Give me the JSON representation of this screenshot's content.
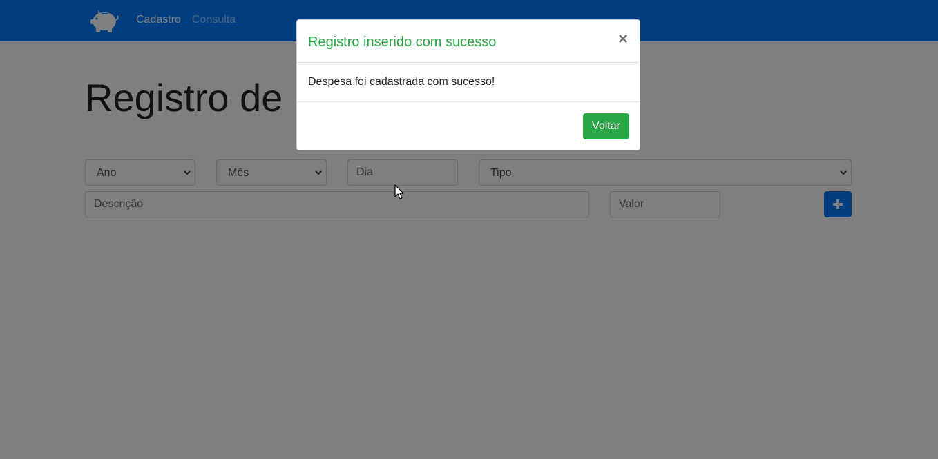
{
  "navbar": {
    "brand_icon": "piggy-bank-icon",
    "links": [
      {
        "label": "Cadastro",
        "active": true
      },
      {
        "label": "Consulta",
        "active": false
      }
    ],
    "bg_color": "#007bff"
  },
  "main": {
    "title": "Registro de",
    "form": {
      "ano": {
        "selected": "Ano"
      },
      "mes": {
        "selected": "Mês"
      },
      "dia": {
        "placeholder": "Dia"
      },
      "tipo": {
        "selected": "Tipo"
      },
      "descricao": {
        "placeholder": "Descrição"
      },
      "valor": {
        "placeholder": "Valor"
      },
      "add_button_icon": "plus-icon"
    }
  },
  "modal": {
    "title": "Registro inserido com sucesso",
    "close_label": "×",
    "body": "Despesa foi cadastrada com sucesso!",
    "button_label": "Voltar",
    "title_color": "#28a745",
    "button_color": "#28a745"
  },
  "cursor_icon": "mouse-pointer-icon"
}
